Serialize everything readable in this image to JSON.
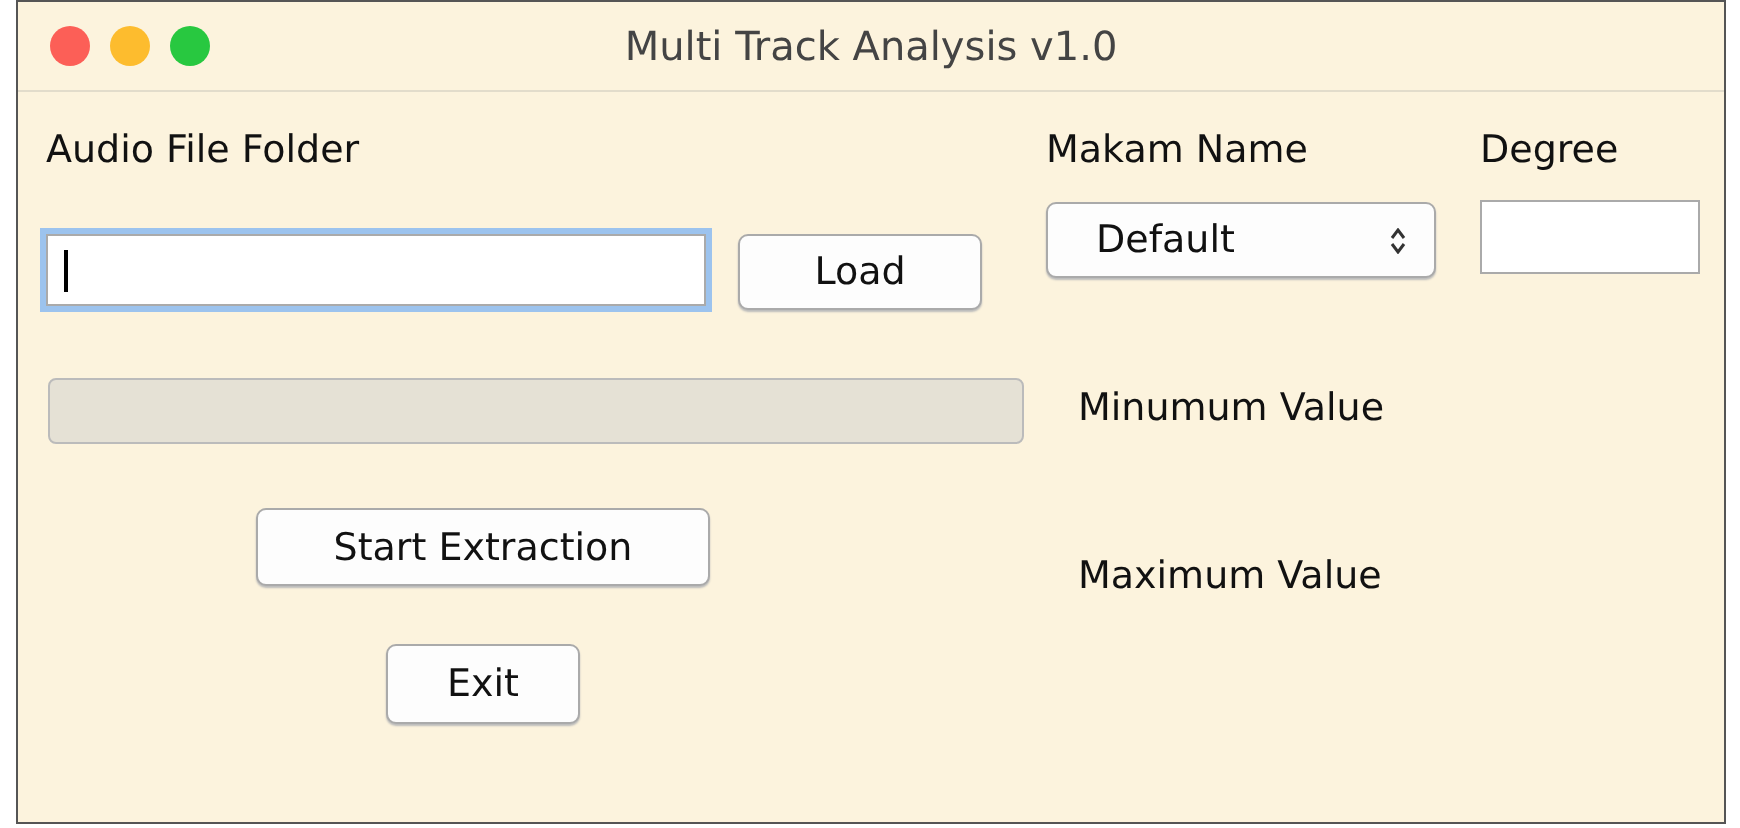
{
  "window": {
    "title": "Multi Track Analysis v1.0"
  },
  "audio_folder": {
    "label": "Audio File Folder",
    "focused": true,
    "button": "Load"
  },
  "makam": {
    "label": "Makam Name",
    "value": "Default"
  },
  "degree": {
    "label": "Degree"
  },
  "progress": {
    "level": 0
  },
  "minimum": {
    "label": "Minumum Value"
  },
  "maximum": {
    "label": "Maximum Value"
  },
  "buttons": [
    "Start Extraction",
    "Exit"
  ]
}
